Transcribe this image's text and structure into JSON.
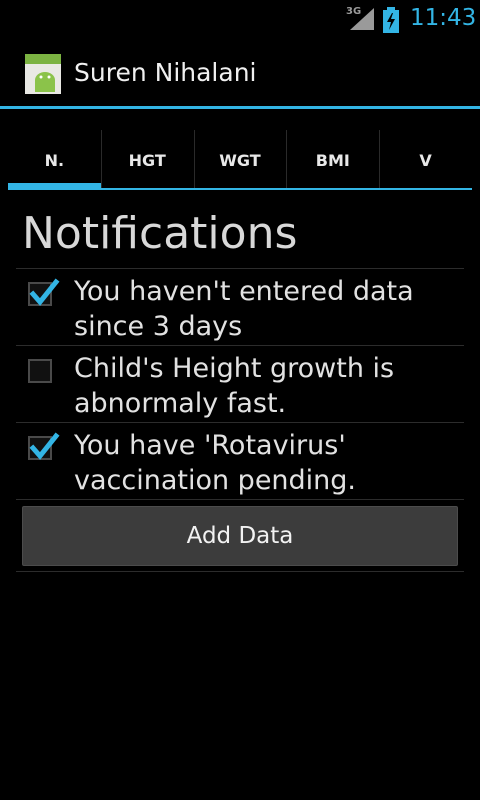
{
  "status_bar": {
    "network": "3G",
    "time": "11:43",
    "icons": [
      "signal-icon",
      "battery-charging-icon"
    ]
  },
  "action_bar": {
    "icon": "android-app-icon",
    "title": "Suren Nihalani"
  },
  "tabs": [
    {
      "label": "N.",
      "selected": true
    },
    {
      "label": "HGT",
      "selected": false
    },
    {
      "label": "WGT",
      "selected": false
    },
    {
      "label": "BMI",
      "selected": false
    },
    {
      "label": "V",
      "selected": false
    }
  ],
  "main": {
    "heading": "Notifications",
    "notifications": [
      {
        "text": "You haven't entered data since 3 days",
        "checked": true
      },
      {
        "text": "Child's Height growth is abnormaly fast.",
        "checked": false
      },
      {
        "text": "You have 'Rotavirus' vaccination pending.",
        "checked": true
      }
    ],
    "add_button_label": "Add Data"
  },
  "colors": {
    "accent": "#33b5e5",
    "background": "#000000",
    "button": "#3c3c3c"
  }
}
